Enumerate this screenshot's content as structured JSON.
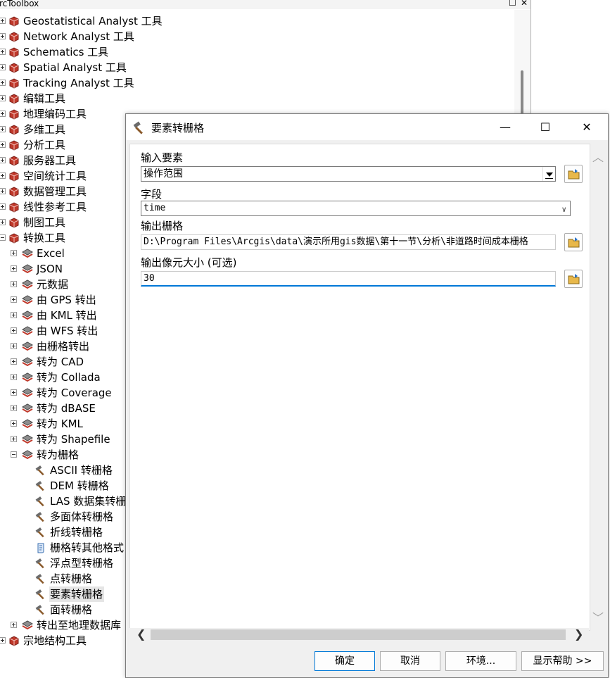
{
  "toolbox": {
    "title": "rcToolbox",
    "title_controls": [
      "☐",
      "✕"
    ],
    "items": [
      {
        "label": "Geostatistical Analyst 工具",
        "level": 0,
        "expander": "plus",
        "icon": "toolbox-icon"
      },
      {
        "label": "Network Analyst 工具",
        "level": 0,
        "expander": "plus",
        "icon": "toolbox-icon"
      },
      {
        "label": "Schematics 工具",
        "level": 0,
        "expander": "plus",
        "icon": "toolbox-icon"
      },
      {
        "label": "Spatial Analyst 工具",
        "level": 0,
        "expander": "plus",
        "icon": "toolbox-icon"
      },
      {
        "label": "Tracking Analyst 工具",
        "level": 0,
        "expander": "plus",
        "icon": "toolbox-icon"
      },
      {
        "label": "编辑工具",
        "level": 0,
        "expander": "plus",
        "icon": "toolbox-icon"
      },
      {
        "label": "地理编码工具",
        "level": 0,
        "expander": "plus",
        "icon": "toolbox-icon"
      },
      {
        "label": "多维工具",
        "level": 0,
        "expander": "plus",
        "icon": "toolbox-icon"
      },
      {
        "label": "分析工具",
        "level": 0,
        "expander": "plus",
        "icon": "toolbox-icon"
      },
      {
        "label": "服务器工具",
        "level": 0,
        "expander": "plus",
        "icon": "toolbox-icon"
      },
      {
        "label": "空间统计工具",
        "level": 0,
        "expander": "plus",
        "icon": "toolbox-icon"
      },
      {
        "label": "数据管理工具",
        "level": 0,
        "expander": "plus",
        "icon": "toolbox-icon"
      },
      {
        "label": "线性参考工具",
        "level": 0,
        "expander": "plus",
        "icon": "toolbox-icon"
      },
      {
        "label": "制图工具",
        "level": 0,
        "expander": "plus",
        "icon": "toolbox-icon"
      },
      {
        "label": "转换工具",
        "level": 0,
        "expander": "minus",
        "icon": "toolbox-icon"
      },
      {
        "label": "Excel",
        "level": 1,
        "expander": "plus",
        "icon": "toolset-icon"
      },
      {
        "label": "JSON",
        "level": 1,
        "expander": "plus",
        "icon": "toolset-icon"
      },
      {
        "label": "元数据",
        "level": 1,
        "expander": "plus",
        "icon": "toolset-icon"
      },
      {
        "label": "由 GPS 转出",
        "level": 1,
        "expander": "plus",
        "icon": "toolset-icon"
      },
      {
        "label": "由 KML 转出",
        "level": 1,
        "expander": "plus",
        "icon": "toolset-icon"
      },
      {
        "label": "由 WFS 转出",
        "level": 1,
        "expander": "plus",
        "icon": "toolset-icon"
      },
      {
        "label": "由栅格转出",
        "level": 1,
        "expander": "plus",
        "icon": "toolset-icon"
      },
      {
        "label": "转为 CAD",
        "level": 1,
        "expander": "plus",
        "icon": "toolset-icon"
      },
      {
        "label": "转为 Collada",
        "level": 1,
        "expander": "plus",
        "icon": "toolset-icon"
      },
      {
        "label": "转为 Coverage",
        "level": 1,
        "expander": "plus",
        "icon": "toolset-icon"
      },
      {
        "label": "转为 dBASE",
        "level": 1,
        "expander": "plus",
        "icon": "toolset-icon"
      },
      {
        "label": "转为 KML",
        "level": 1,
        "expander": "plus",
        "icon": "toolset-icon"
      },
      {
        "label": "转为 Shapefile",
        "level": 1,
        "expander": "plus",
        "icon": "toolset-icon"
      },
      {
        "label": "转为栅格",
        "level": 1,
        "expander": "minus",
        "icon": "toolset-icon"
      },
      {
        "label": "ASCII 转栅格",
        "level": 2,
        "expander": "",
        "icon": "hammer-icon"
      },
      {
        "label": "DEM 转栅格",
        "level": 2,
        "expander": "",
        "icon": "hammer-icon"
      },
      {
        "label": "LAS 数据集转栅",
        "level": 2,
        "expander": "",
        "icon": "hammer-icon"
      },
      {
        "label": "多面体转栅格",
        "level": 2,
        "expander": "",
        "icon": "hammer-icon"
      },
      {
        "label": "折线转栅格",
        "level": 2,
        "expander": "",
        "icon": "hammer-icon"
      },
      {
        "label": "栅格转其他格式",
        "level": 2,
        "expander": "",
        "icon": "script-icon"
      },
      {
        "label": "浮点型转栅格",
        "level": 2,
        "expander": "",
        "icon": "hammer-icon"
      },
      {
        "label": "点转栅格",
        "level": 2,
        "expander": "",
        "icon": "hammer-icon"
      },
      {
        "label": "要素转栅格",
        "level": 2,
        "expander": "",
        "icon": "hammer-icon",
        "selected": true
      },
      {
        "label": "面转栅格",
        "level": 2,
        "expander": "",
        "icon": "hammer-icon"
      },
      {
        "label": "转出至地理数据库",
        "level": 1,
        "expander": "plus",
        "icon": "toolset-icon"
      },
      {
        "label": "宗地结构工具",
        "level": 0,
        "expander": "plus",
        "icon": "toolbox-icon"
      }
    ]
  },
  "dialog": {
    "title": "要素转栅格",
    "controls": {
      "minimize": "—",
      "maximize": "☐",
      "close": "✕"
    },
    "fields": [
      {
        "label": "输入要素",
        "value": "操作范围",
        "kind": "combo",
        "has_folder": true
      },
      {
        "label": "字段",
        "value": "time",
        "kind": "dropdown",
        "has_folder": false
      },
      {
        "label": "输出栅格",
        "value": "D:\\Program Files\\Arcgis\\data\\演示所用gis数据\\第十一节\\分析\\非道路时间成本栅格",
        "kind": "text",
        "has_folder": true
      },
      {
        "label": "输出像元大小 (可选)",
        "value": "30",
        "kind": "text-active",
        "has_folder": true
      }
    ],
    "buttons": {
      "ok": "确定",
      "cancel": "取消",
      "env": "环境...",
      "help": "显示帮助 >>"
    }
  },
  "colors": {
    "accent": "#0078d7",
    "toolbox_red": "#c0392b"
  }
}
